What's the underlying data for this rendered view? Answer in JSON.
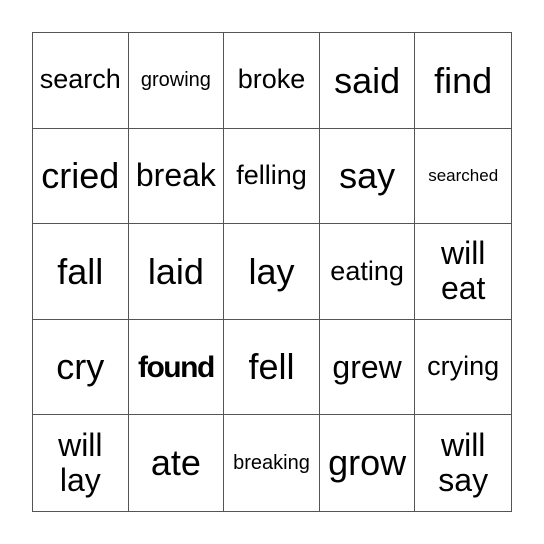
{
  "board": {
    "cells": [
      "search",
      "growing",
      "broke",
      "said",
      "find",
      "cried",
      "break",
      "felling",
      "say",
      "searched",
      "fall",
      "laid",
      "lay",
      "eating",
      "will eat",
      "cry",
      "found",
      "fell",
      "grew",
      "crying",
      "will lay",
      "ate",
      "breaking",
      "grow",
      "will say"
    ]
  }
}
